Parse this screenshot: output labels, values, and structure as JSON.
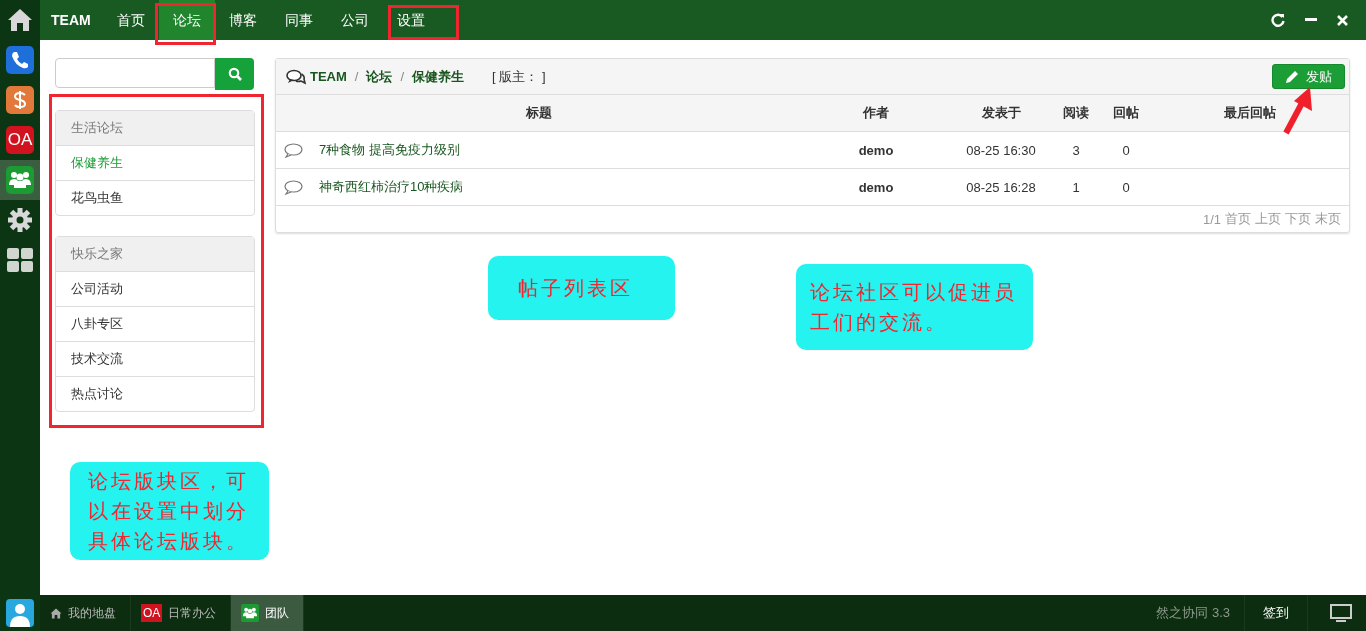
{
  "dock": [
    {
      "kind": "home",
      "selected": false
    },
    {
      "kind": "phone",
      "selected": false
    },
    {
      "kind": "dollar",
      "selected": false
    },
    {
      "kind": "oa",
      "label": "OA",
      "selected": false
    },
    {
      "kind": "team",
      "selected": true
    },
    {
      "kind": "gear",
      "selected": false
    },
    {
      "kind": "grid",
      "selected": false
    }
  ],
  "topnav": {
    "brand": "TEAM",
    "tabs": [
      {
        "label": "首页",
        "selected": false
      },
      {
        "label": "论坛",
        "selected": true
      },
      {
        "label": "博客",
        "selected": false
      },
      {
        "label": "同事",
        "selected": false
      },
      {
        "label": "公司",
        "selected": false
      },
      {
        "label": "设置",
        "selected": false
      }
    ]
  },
  "forum_groups": [
    {
      "title": "生活论坛",
      "boards": [
        {
          "label": "保健养生",
          "selected": true
        },
        {
          "label": "花鸟虫鱼",
          "selected": false
        }
      ]
    },
    {
      "title": "快乐之家",
      "boards": [
        {
          "label": "公司活动",
          "selected": false
        },
        {
          "label": "八卦专区",
          "selected": false
        },
        {
          "label": "技术交流",
          "selected": false
        },
        {
          "label": "热点讨论",
          "selected": false
        }
      ]
    }
  ],
  "breadcrumb": [
    "TEAM",
    "论坛",
    "保健养生"
  ],
  "breadcrumb_separator": "/",
  "moderator": "[ 版主： ]",
  "new_post_button": "发贴",
  "table": {
    "columns": [
      "标题",
      "作者",
      "发表于",
      "阅读",
      "回帖",
      "最后回帖"
    ],
    "rows": [
      {
        "title": "7种食物 提高免疫力级别",
        "author": "demo",
        "posted": "08-25 16:30",
        "views": "3",
        "replies": "0"
      },
      {
        "title": "神奇西红柿治疗10种疾病",
        "author": "demo",
        "posted": "08-25 16:28",
        "views": "1",
        "replies": "0"
      }
    ]
  },
  "pagination": {
    "count": "1/1",
    "links": [
      "首页",
      "上页",
      "下页",
      "末页"
    ]
  },
  "annotations": {
    "callouts": [
      {
        "text": "帖子列表区"
      },
      {
        "text": "论坛社区可以促进员工们的交流。"
      },
      {
        "text": "论坛版块区，可以在设置中划分具体论坛版块。"
      }
    ]
  },
  "taskbar": {
    "items": [
      {
        "kind": "home",
        "label": "我的地盘",
        "selected": false
      },
      {
        "kind": "oa",
        "badge": "OA",
        "label": "日常办公",
        "selected": false
      },
      {
        "kind": "team",
        "label": "团队",
        "selected": true
      }
    ],
    "version": "然之协同 3.3",
    "sign_in": "签到"
  }
}
